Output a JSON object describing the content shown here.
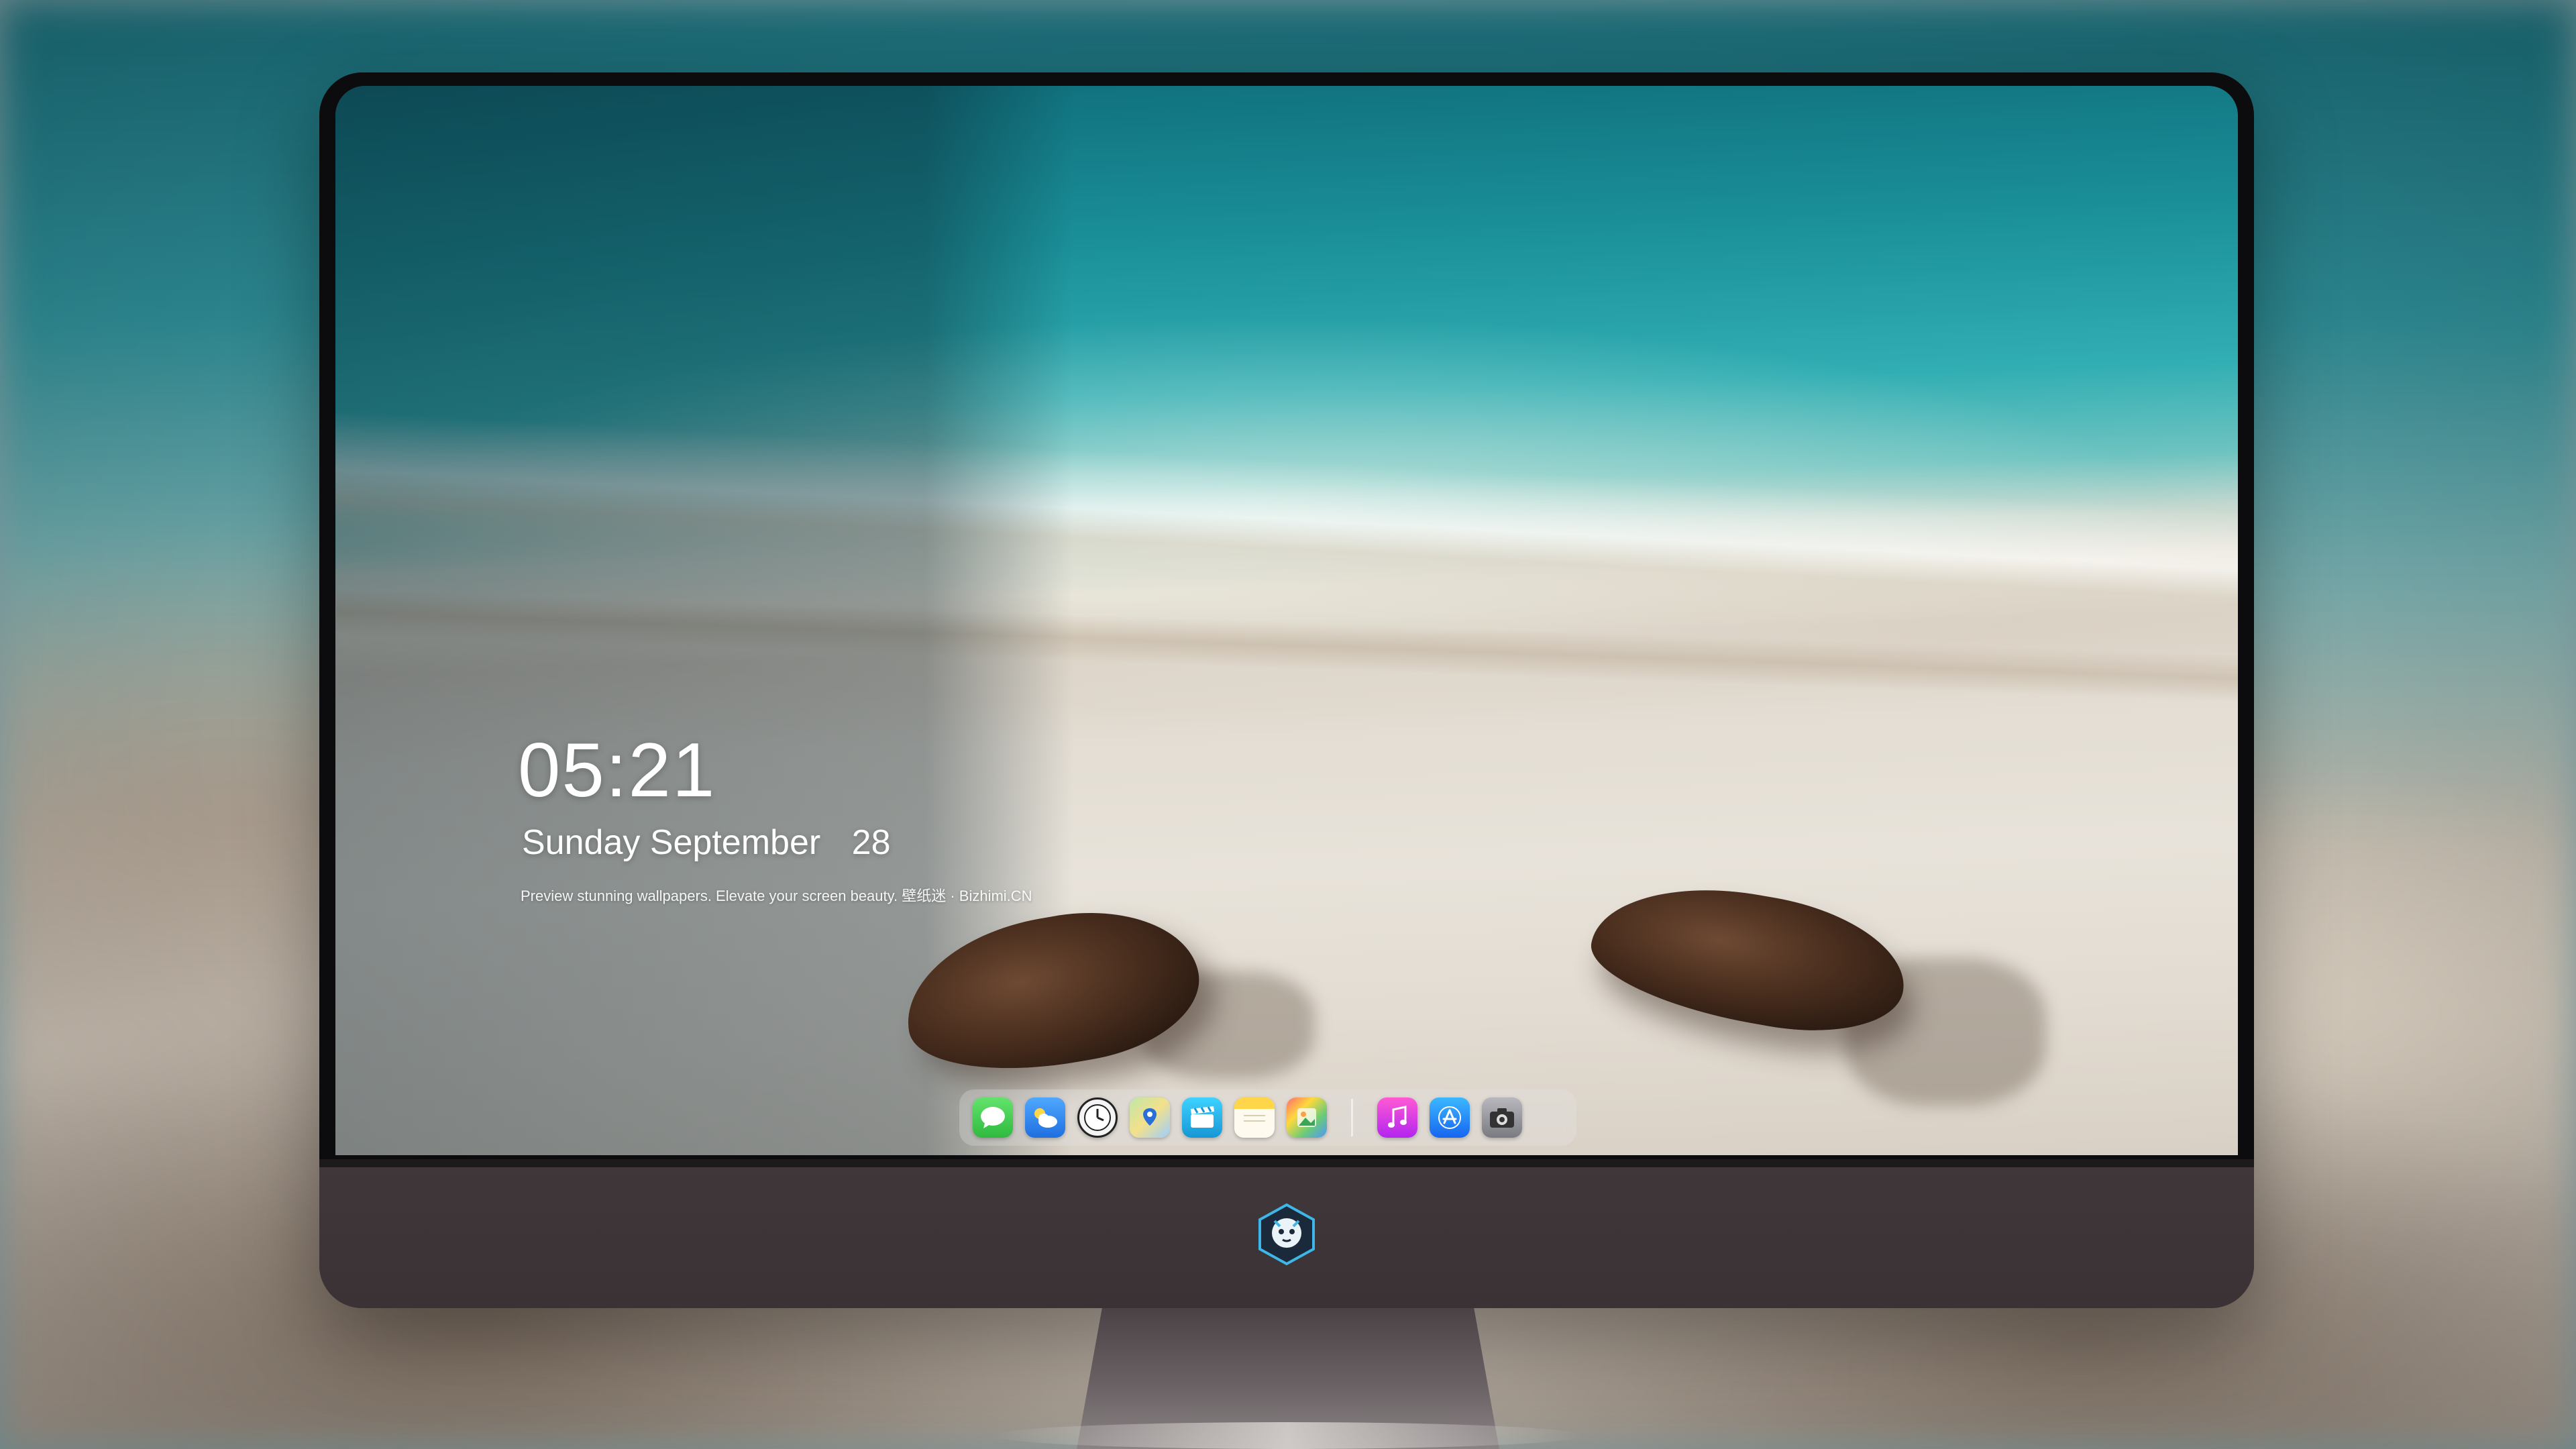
{
  "lock_screen": {
    "time": "05:21",
    "weekday": "Sunday",
    "month": "September",
    "day": "28",
    "tagline": "Preview stunning wallpapers. Elevate your screen beauty. 壁纸迷 · Bizhimi.CN"
  },
  "dock": {
    "apps": [
      {
        "icon": "messages-icon"
      },
      {
        "icon": "weather-icon"
      },
      {
        "icon": "clock-icon"
      },
      {
        "icon": "maps-icon"
      },
      {
        "icon": "clips-icon"
      },
      {
        "icon": "notes-icon"
      },
      {
        "icon": "photos-icon"
      },
      {
        "icon": "music-icon"
      },
      {
        "icon": "app-store-icon"
      },
      {
        "icon": "camera-icon"
      }
    ]
  },
  "colors": {
    "monitor_chin": "#3b3335",
    "bezel": "#0c0b0d",
    "ocean": "#1a8f98",
    "sand": "#e3ddd3"
  }
}
